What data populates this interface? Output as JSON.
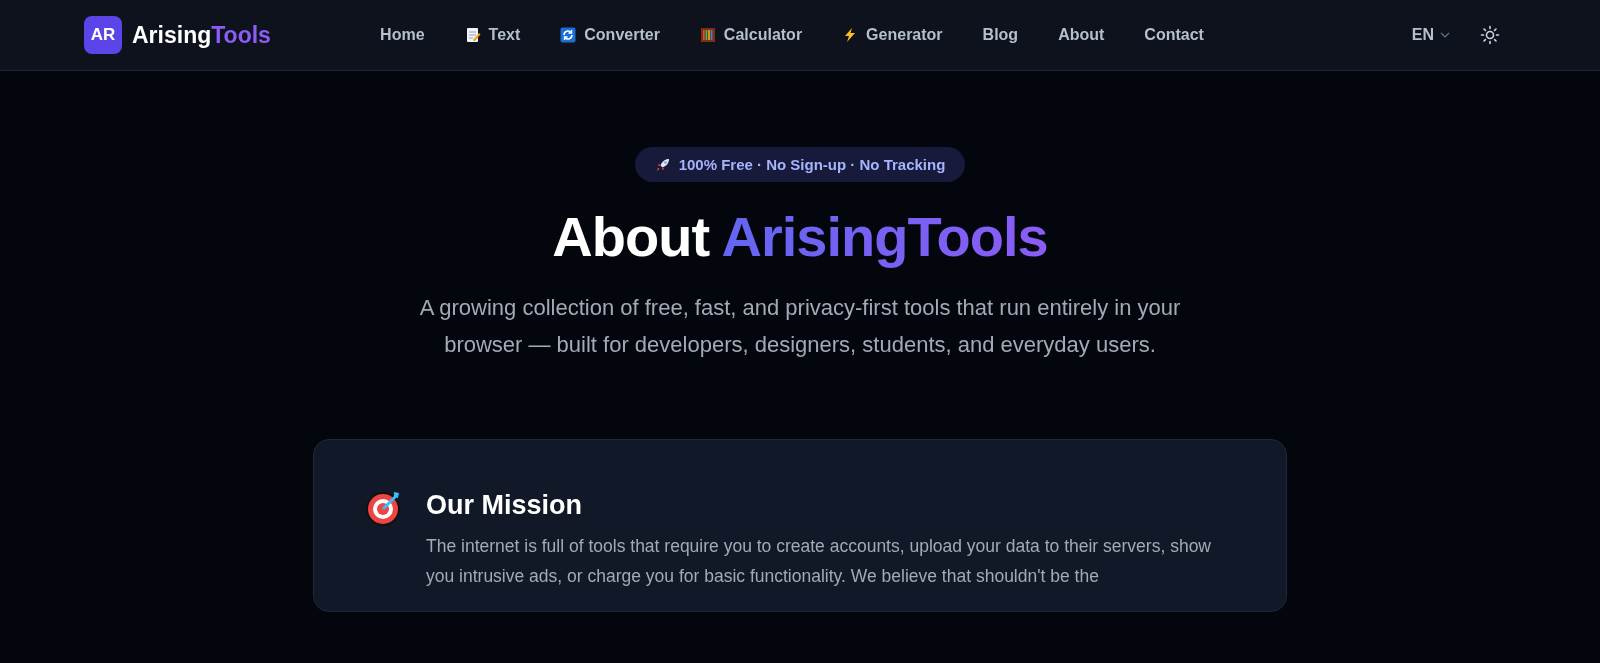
{
  "header": {
    "logo_mark": "AR",
    "logo_word": "Arising",
    "logo_word_accent": "Tools",
    "nav": [
      {
        "label": "Home",
        "kind": "plain"
      },
      {
        "label": "Text",
        "kind": "note"
      },
      {
        "label": "Converter",
        "kind": "refresh"
      },
      {
        "label": "Calculator",
        "kind": "abacus"
      },
      {
        "label": "Generator",
        "kind": "bolt"
      },
      {
        "label": "Blog",
        "kind": "plain"
      },
      {
        "label": "About",
        "kind": "plain"
      },
      {
        "label": "Contact",
        "kind": "plain"
      }
    ],
    "language": "EN"
  },
  "hero": {
    "badge": "100% Free · No Sign-up · No Tracking",
    "title": "About",
    "title_accent": "ArisingTools",
    "subtitle": "A growing collection of free, fast, and privacy-first tools that run entirely in your browser — built for developers, designers, students, and everyday users."
  },
  "mission": {
    "title": "Our Mission",
    "text": "The internet is full of tools that require you to create accounts, upload your data to their servers, show you intrusive ads, or charge you for basic functionality. We believe that shouldn't be the"
  }
}
